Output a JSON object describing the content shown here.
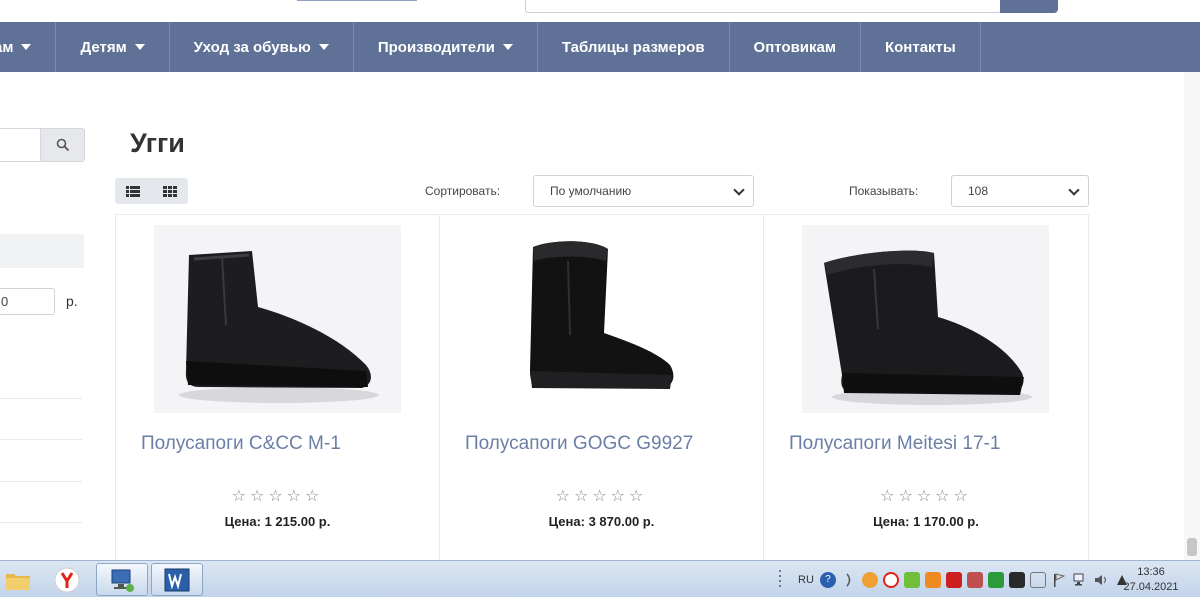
{
  "navbar": {
    "items": [
      {
        "label": "ам",
        "has_caret": true
      },
      {
        "label": "Детям",
        "has_caret": true
      },
      {
        "label": "Уход за обувью",
        "has_caret": true
      },
      {
        "label": "Производители",
        "has_caret": true
      },
      {
        "label": "Таблицы размеров",
        "has_caret": false
      },
      {
        "label": "Оптовикам",
        "has_caret": false
      },
      {
        "label": "Контакты",
        "has_caret": false
      }
    ]
  },
  "sidebar": {
    "price_to_value": "0",
    "price_unit": "р."
  },
  "main": {
    "title": "Угги",
    "sort_label": "Сортировать:",
    "sort_value": "По умолчанию",
    "show_label": "Показывать:",
    "show_value": "108"
  },
  "products": [
    {
      "name": "Полусапоги C&CC M-1",
      "stars": "☆☆☆☆☆",
      "price": "Цена: 1 215.00 р.",
      "rating": 0
    },
    {
      "name": "Полусапоги GOGC G9927",
      "stars": "☆☆☆☆☆",
      "price": "Цена: 3 870.00 р.",
      "rating": 0
    },
    {
      "name": "Полусапоги Meitesi 17-1",
      "stars": "☆☆☆☆☆",
      "price": "Цена: 1 170.00 р.",
      "rating": 0
    }
  ],
  "taskbar": {
    "lang": "RU",
    "time": "13:36",
    "date": "27.04.2021"
  },
  "colors": {
    "nav_bg": "#5f7196",
    "link": "#6b7fa6"
  }
}
